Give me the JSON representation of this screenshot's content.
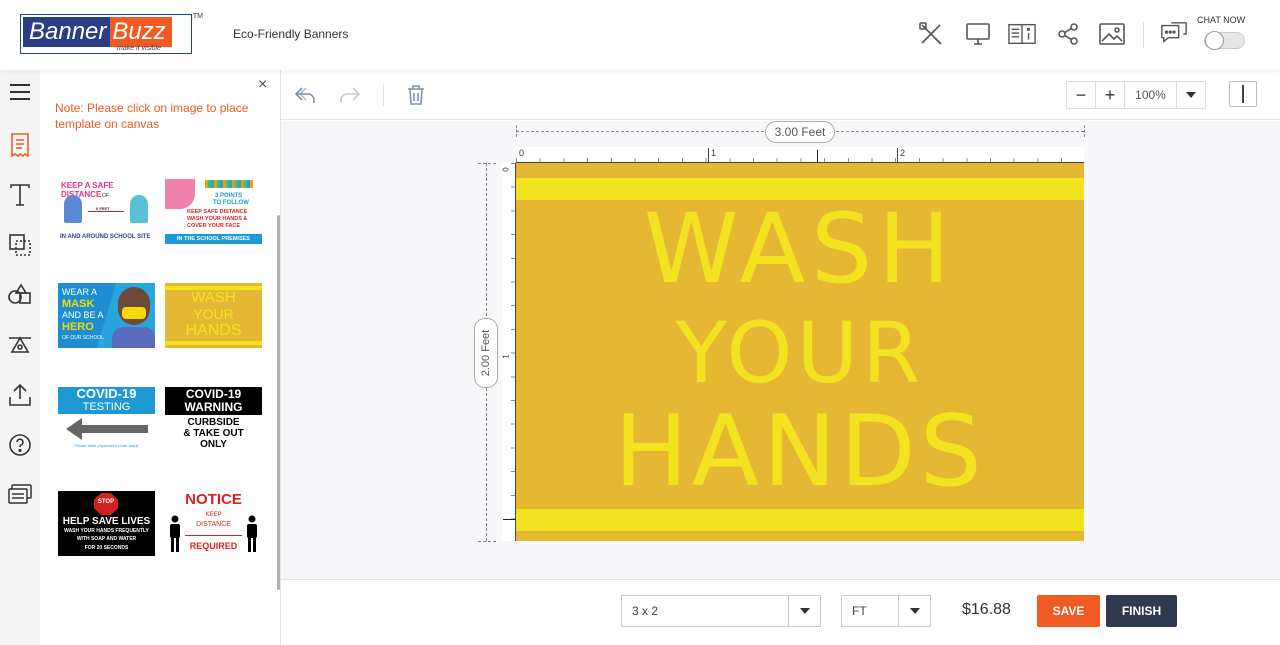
{
  "header": {
    "logo_part1": "Banner",
    "logo_part2": "Buzz",
    "logo_tagline": "make it visible",
    "logo_tm": "TM",
    "project_title": "Eco-Friendly Banners",
    "chat_label": "CHAT NOW",
    "icons": [
      "tools-icon",
      "monitor-icon",
      "book-info-icon",
      "share-icon",
      "image-icon",
      "chat-icon"
    ]
  },
  "sidebar": {
    "icons": [
      "menu-icon",
      "templates-icon",
      "text-icon",
      "layers-icon",
      "shapes-icon",
      "clipart-icon",
      "upload-icon",
      "help-icon",
      "chat-icon"
    ],
    "active_index": 1,
    "accent": "#f15a22"
  },
  "panel": {
    "note": "Note: Please click on image to place template on canvas",
    "close": "×"
  },
  "templates": {
    "t1": {
      "line1": "KEEP A SAFE DISTANCE",
      "line2": "6 FEET",
      "line3": "IN AND AROUND SCHOOL SITE",
      "small": "OF"
    },
    "t2": {
      "line1": "3 POINTS",
      "line2": "TO FOLLOW",
      "line3": "KEEP SAFE DISTANCE",
      "line4": "WASH YOUR HANDS &",
      "line5": "COVER YOUR FACE",
      "line6": "IN THE SCHOOL PREMISES"
    },
    "t3": {
      "line1": "WEAR A",
      "line2": "MASK",
      "line3": "AND BE A",
      "line4": "HERO",
      "line5": "OF OUR SCHOOL"
    },
    "t4": {
      "line1": "WASH",
      "line2": "YOUR",
      "line3": "HANDS"
    },
    "t5": {
      "line1": "COVID-19",
      "line2": "TESTING",
      "line3": "Please have physician's order ready"
    },
    "t6": {
      "line1": "COVID-19",
      "line2": "WARNING",
      "line3": "CURBSIDE",
      "line4": "& TAKE OUT",
      "line5": "ONLY"
    },
    "t7": {
      "stop": "STOP",
      "line1": "HELP SAVE LIVES",
      "line2": "WASH YOUR HANDS FREQUENTLY",
      "line3": "WITH SOAP AND WATER",
      "line4": "FOR 20 SECONDS"
    },
    "t8": {
      "line1": "NOTICE",
      "line2": "KEEP",
      "line3": "DISTANCE",
      "line4": "REQUIRED"
    }
  },
  "toolbar": {
    "zoom_minus": "−",
    "zoom_plus": "+",
    "zoom_value": "100%"
  },
  "canvas": {
    "width_label": "3.00 Feet",
    "height_label": "2.00 Feet",
    "ruler_top": [
      "0",
      "1",
      "2"
    ],
    "ruler_left": [
      "0",
      "1"
    ],
    "line1": "WASH",
    "line2": "YOUR",
    "line3": "HANDS",
    "bg_color": "#e4b833",
    "text_color": "#f2e320"
  },
  "footer": {
    "size_value": "3 x 2",
    "unit_value": "FT",
    "price": "$16.88",
    "save_label": "SAVE",
    "finish_label": "FINISH",
    "save_color": "#f15a22",
    "finish_color": "#2f3a4f"
  }
}
